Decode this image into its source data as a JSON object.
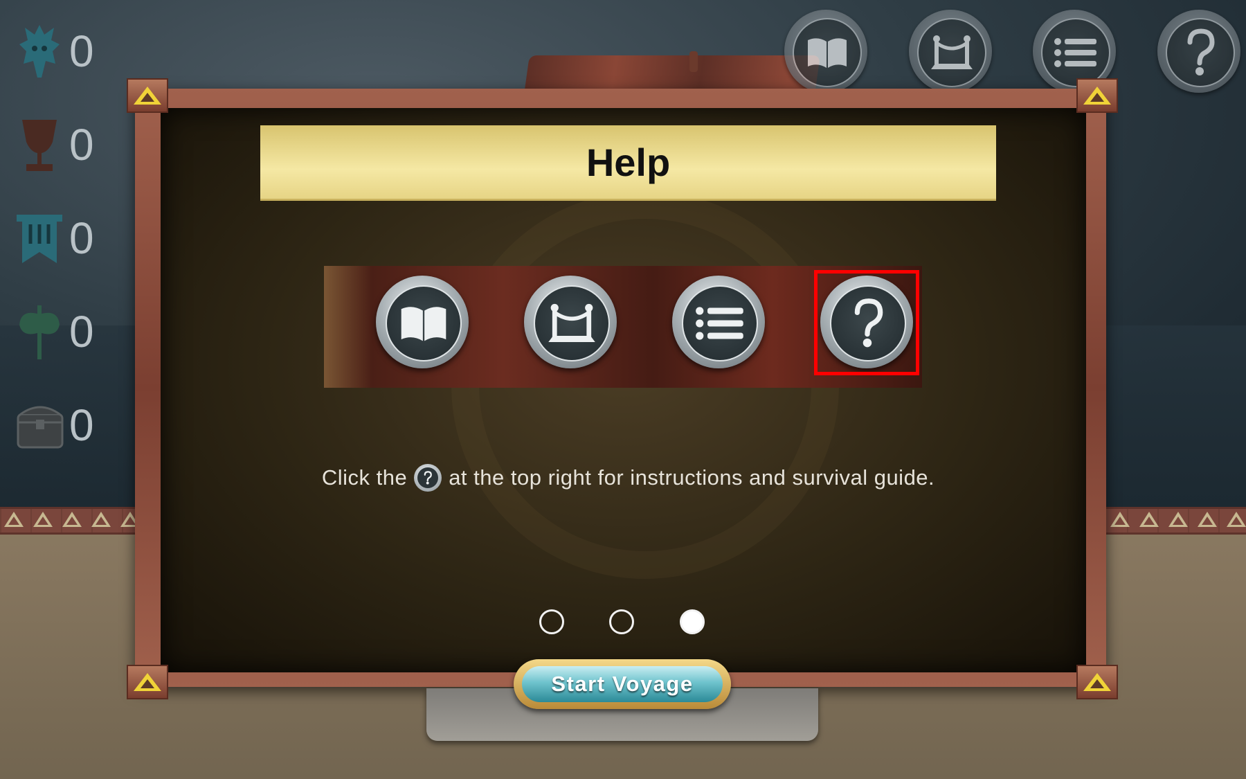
{
  "stats": [
    {
      "icon": "dragon-head-icon",
      "value": "0",
      "color": "#2a6b78"
    },
    {
      "icon": "goblet-icon",
      "value": "0",
      "color": "#4a2a22"
    },
    {
      "icon": "banner-icon",
      "value": "0",
      "color": "#2a6b78"
    },
    {
      "icon": "axe-icon",
      "value": "0",
      "color": "#2e5c48"
    },
    {
      "icon": "treasure-chest-icon",
      "value": "0",
      "color": "#4a4d4f"
    }
  ],
  "top_buttons": [
    "book-icon",
    "rope-barrier-icon",
    "list-icon",
    "help-icon"
  ],
  "dialog": {
    "title": "Help",
    "instruction_before": "Click the",
    "instruction_after": "at the top right for instructions and survival guide.",
    "strip_buttons": [
      "book-icon",
      "rope-barrier-icon",
      "list-icon",
      "help-icon"
    ],
    "highlighted": "help-icon",
    "page_indicator": {
      "total": 3,
      "current": 3
    }
  },
  "start_button_label": "Start Voyage",
  "colors": {
    "title_bar": "#f0df95",
    "frame": "#8f4c3b",
    "highlight": "#ff0000",
    "corner_triangle": "#f0d338"
  }
}
